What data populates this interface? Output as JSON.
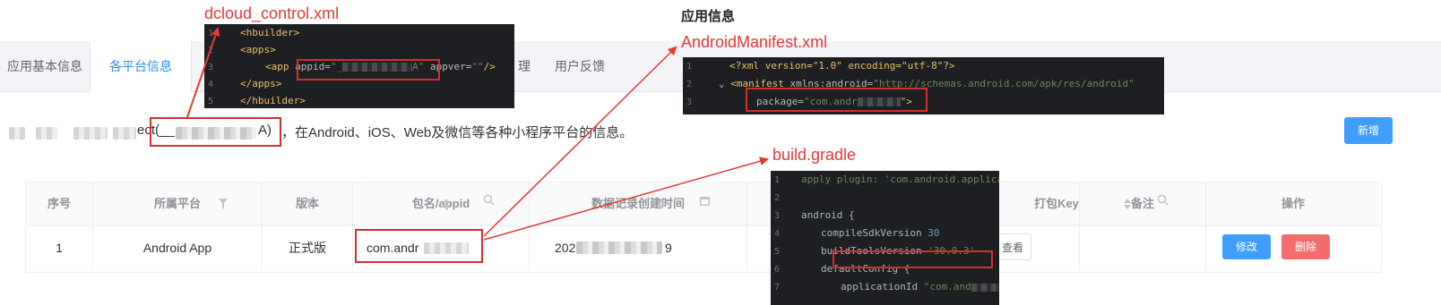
{
  "page_title": "应用信息",
  "tabs": [
    {
      "label": "应用基本信息",
      "active": false
    },
    {
      "label": "各平台信息",
      "active": true
    },
    {
      "label": "理",
      "active": false
    },
    {
      "label": "用户反馈",
      "active": false
    }
  ],
  "description": {
    "app_name_suffix": "ect(",
    "appid_prefix": "__",
    "appid_suffix": "A)",
    "text": "，在Android、iOS、Web及微信等各种小程序平台的信息。"
  },
  "buttons": {
    "add": "新增",
    "edit": "修改",
    "delete": "删除",
    "view": "查看"
  },
  "table": {
    "headers": [
      "序号",
      "所属平台",
      "版本",
      "包名/appid",
      "数据记录创建时间",
      "打包Key",
      "备注",
      "操作"
    ],
    "row": {
      "index": "1",
      "platform": "Android App",
      "version": "正式版",
      "package_prefix": "com.andr",
      "created_prefix": "202",
      "created_suffix": "9"
    }
  },
  "annotations": {
    "dcloud": "dcloud_control.xml",
    "manifest": "AndroidManifest.xml",
    "gradle": "build.gradle"
  },
  "code_dcloud": {
    "line_numbers": [
      "1",
      "2",
      "3",
      "4",
      "5"
    ],
    "l1": "<hbuilder>",
    "l2": "<apps>",
    "l3_tag": "<app",
    "l3_attr": "appid=",
    "l3_val_prefix": "\"_",
    "l3_val_suffix": "A\"",
    "l3_attr2": "appver=",
    "l3_val2": "\"\"",
    "l3_end": "/>",
    "l4": "</apps>",
    "l5": "</hbuilder>"
  },
  "code_manifest": {
    "line_numbers": [
      "1",
      "2",
      "3"
    ],
    "l1": "<?xml version=\"1.0\" encoding=\"utf-8\"?>",
    "l2_tag": "<manifest",
    "l2_attr": "xmlns:android=",
    "l2_val": "\"http://schemas.android.com/apk/res/android\"",
    "l3_attr": "package=",
    "l3_val_prefix": "\"com.andr",
    "l3_end": "\">"
  },
  "code_gradle": {
    "line_numbers": [
      "1",
      "2",
      "3",
      "4",
      "5",
      "6",
      "7"
    ],
    "l1": "apply plugin: 'com.android.application'",
    "l2": "",
    "l3": "android {",
    "l4_key": "compileSdkVersion",
    "l4_val": "30",
    "l5_key": "buildToolsVersion",
    "l5_val": "'30.0.3'",
    "l6": "defaultConfig {",
    "l7_key": "applicationId",
    "l7_val_prefix": "\"com.and",
    "l7_end": "\""
  },
  "colors": {
    "primary": "#409eff",
    "danger": "#f56c6c",
    "annotation_red": "#e53935"
  }
}
